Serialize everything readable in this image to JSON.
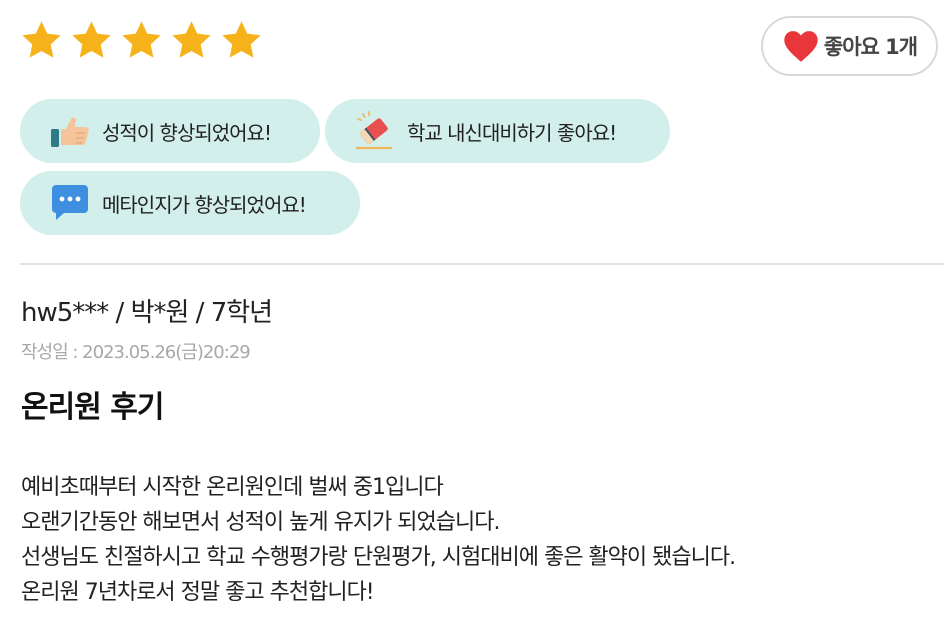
{
  "rating": {
    "stars": 5,
    "max": 5,
    "star_color": "#f6b21b"
  },
  "like": {
    "label": "좋아요 1개",
    "icon": "heart-icon",
    "heart_color": "#e8363b"
  },
  "tags": [
    {
      "icon": "thumbs-up-icon",
      "label": "성적이 향상되었어요!"
    },
    {
      "icon": "pencil-eraser-icon",
      "label": "학교 내신대비하기 좋아요!"
    },
    {
      "icon": "chat-bubble-icon",
      "label": "메타인지가 향상되었어요!"
    }
  ],
  "tag_bg_color": "#d3efeb",
  "review": {
    "author": "hw5*** / 박*원 / 7학년",
    "date": "작성일 : 2023.05.26(금)20:29",
    "title": "온리원 후기",
    "body_lines": [
      "예비초때부터 시작한 온리원인데 벌써 중1입니다",
      "오랜기간동안 해보면서 성적이 높게 유지가 되었습니다.",
      "선생님도 친절하시고 학교 수행평가랑 단원평가, 시험대비에 좋은 활약이 됐습니다.",
      "온리원 7년차로서 정말 좋고 추천합니다!"
    ]
  }
}
